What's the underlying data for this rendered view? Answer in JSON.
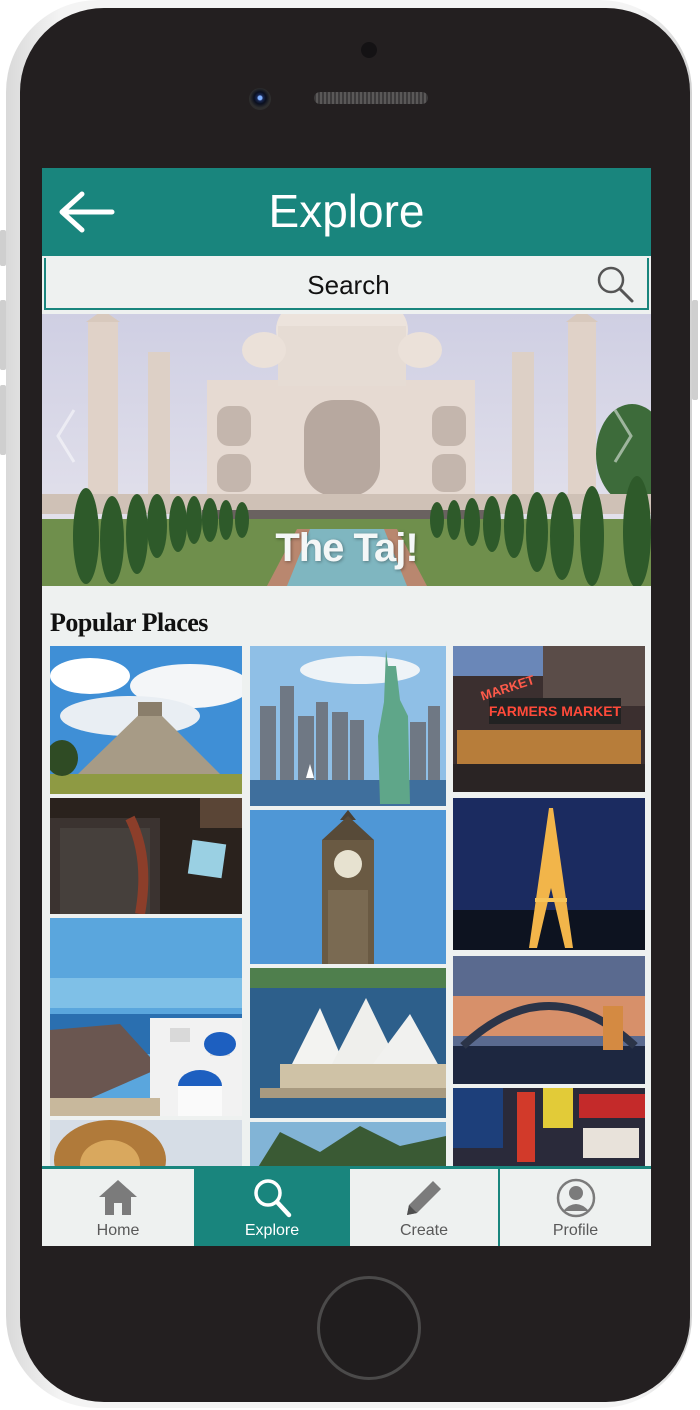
{
  "header": {
    "title": "Explore",
    "back_icon": "back-arrow-icon"
  },
  "search": {
    "label": "Search",
    "icon": "search-icon"
  },
  "hero": {
    "caption": "The Taj!",
    "prev_icon": "chevron-left-icon",
    "next_icon": "chevron-right-icon"
  },
  "popular": {
    "title": "Popular Places",
    "photos": [
      "Pyramid",
      "Statue of Liberty",
      "Farmers Market",
      "Aquarium",
      "Big Ben",
      "Eiffel Tower",
      "Santorini",
      "Sydney Opera House",
      "Harbour Bridge",
      "Lion",
      "Islands",
      "City Signs"
    ],
    "signs": {
      "market_top": "MARKET",
      "market_banner": "FARMERS MARKET"
    }
  },
  "tabbar": {
    "items": [
      {
        "label": "Home",
        "icon": "home-icon"
      },
      {
        "label": "Explore",
        "icon": "search-icon"
      },
      {
        "label": "Create",
        "icon": "pencil-icon"
      },
      {
        "label": "Profile",
        "icon": "user-icon"
      }
    ],
    "active": "Explore"
  },
  "colors": {
    "accent": "#19857d",
    "screen_bg": "#eef1f0",
    "phone_body": "#231f20"
  }
}
